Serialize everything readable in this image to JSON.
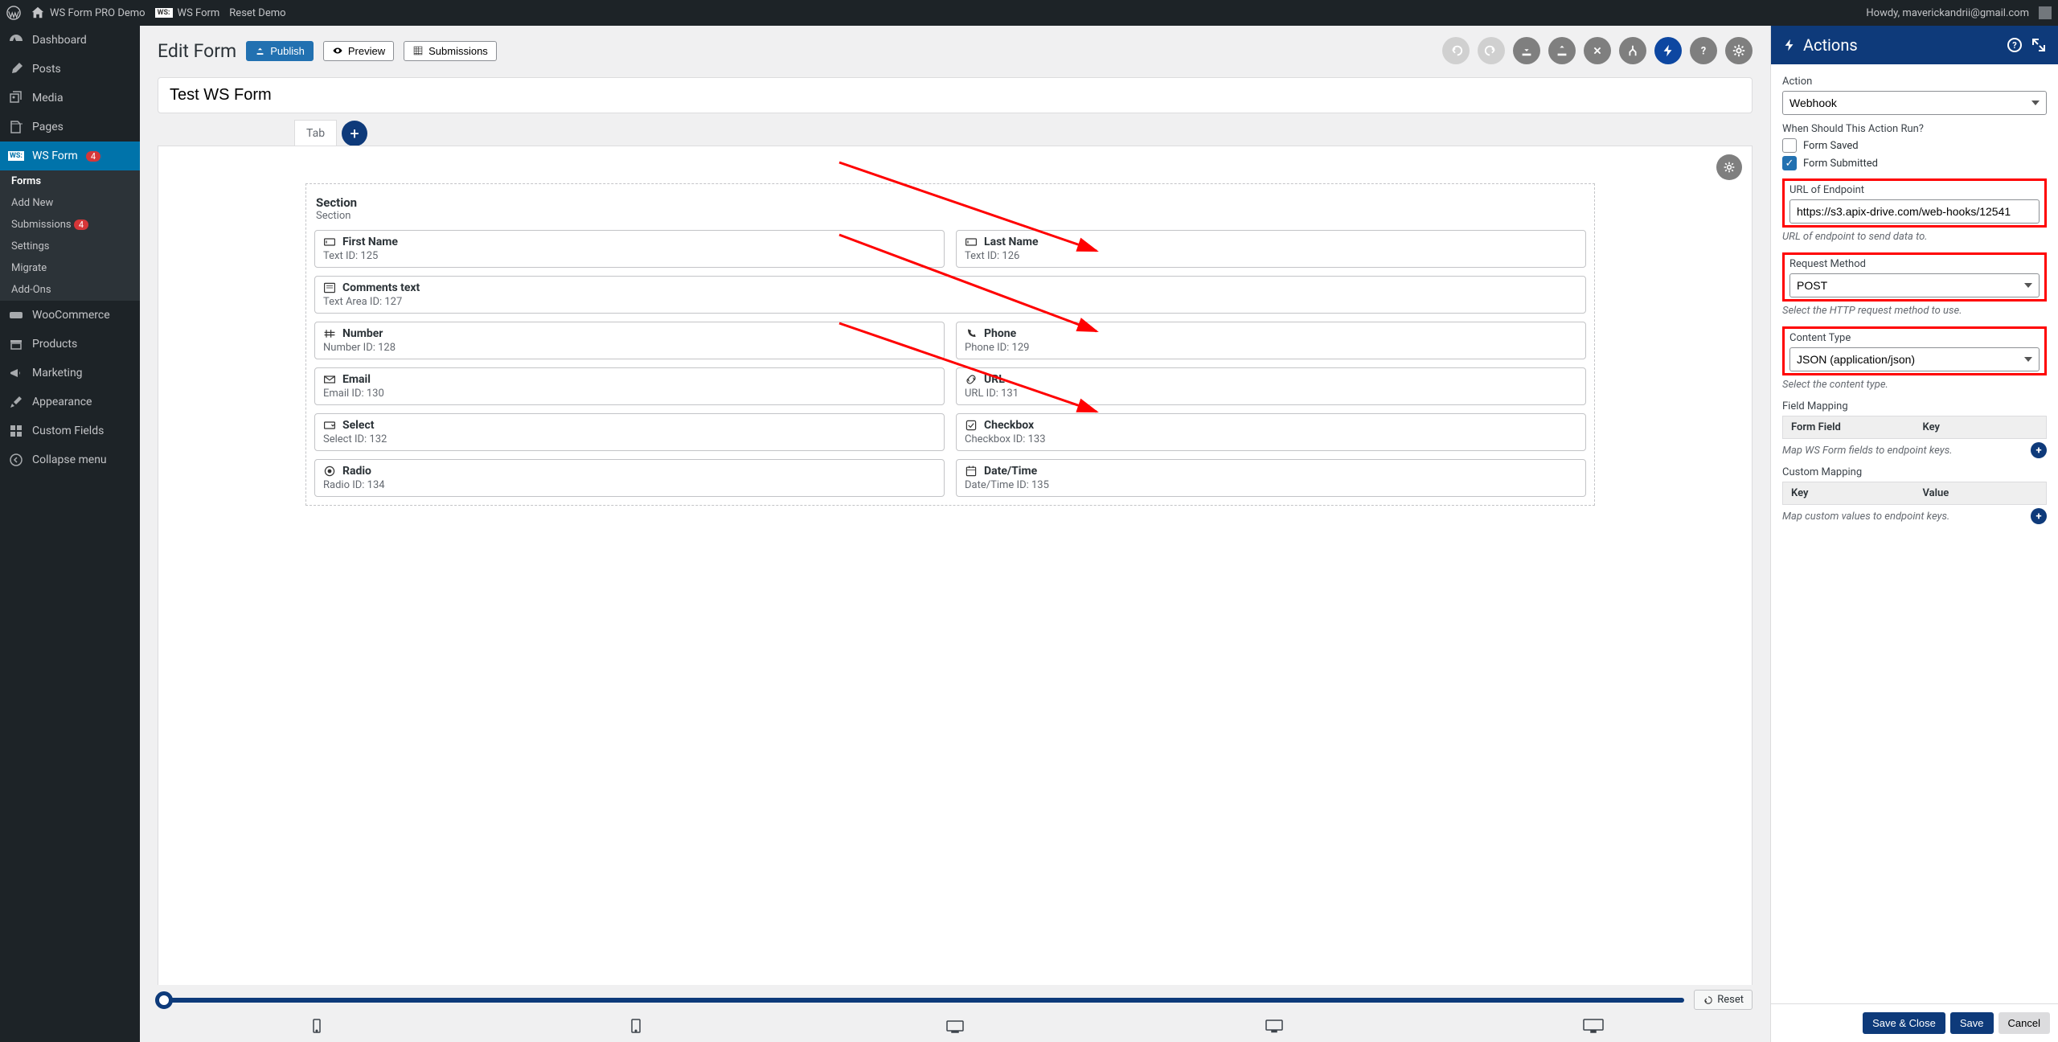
{
  "topbar": {
    "site": "WS Form PRO Demo",
    "wsform": "WS Form",
    "reset": "Reset Demo",
    "howdy": "Howdy, maverickandrii@gmail.com"
  },
  "sidebar": {
    "items": [
      {
        "label": "Dashboard",
        "icon": "dashboard"
      },
      {
        "label": "Posts",
        "icon": "pin"
      },
      {
        "label": "Media",
        "icon": "media"
      },
      {
        "label": "Pages",
        "icon": "pages"
      },
      {
        "label": "WS Form",
        "icon": "wsform",
        "active": true,
        "badge": "4"
      },
      {
        "label": "WooCommerce",
        "icon": "woo"
      },
      {
        "label": "Products",
        "icon": "products"
      },
      {
        "label": "Marketing",
        "icon": "marketing"
      },
      {
        "label": "Appearance",
        "icon": "appearance"
      },
      {
        "label": "Custom Fields",
        "icon": "customfields"
      },
      {
        "label": "Collapse menu",
        "icon": "collapse"
      }
    ],
    "sub": [
      {
        "label": "Forms",
        "sel": true
      },
      {
        "label": "Add New"
      },
      {
        "label": "Submissions",
        "badge": "4"
      },
      {
        "label": "Settings"
      },
      {
        "label": "Migrate"
      },
      {
        "label": "Add-Ons"
      }
    ]
  },
  "header": {
    "title": "Edit Form",
    "publish": "Publish",
    "preview": "Preview",
    "submissions": "Submissions"
  },
  "form": {
    "name": "Test WS Form",
    "tab": "Tab"
  },
  "section": {
    "title": "Section",
    "sub": "Section"
  },
  "fields": [
    {
      "name": "First Name",
      "meta": "Text  ID: 125",
      "icon": "text"
    },
    {
      "name": "Last Name",
      "meta": "Text  ID: 126",
      "icon": "text"
    },
    {
      "name": "Comments text",
      "meta": "Text Area  ID: 127",
      "icon": "textarea",
      "full": true
    },
    {
      "name": "Number",
      "meta": "Number  ID: 128",
      "icon": "number"
    },
    {
      "name": "Phone",
      "meta": "Phone  ID: 129",
      "icon": "phone"
    },
    {
      "name": "Email",
      "meta": "Email  ID: 130",
      "icon": "email"
    },
    {
      "name": "URL",
      "meta": "URL  ID: 131",
      "icon": "url"
    },
    {
      "name": "Select",
      "meta": "Select  ID: 132",
      "icon": "select"
    },
    {
      "name": "Checkbox",
      "meta": "Checkbox  ID: 133",
      "icon": "checkbox"
    },
    {
      "name": "Radio",
      "meta": "Radio  ID: 134",
      "icon": "radio"
    },
    {
      "name": "Date/Time",
      "meta": "Date/Time  ID: 135",
      "icon": "datetime"
    }
  ],
  "bottom": {
    "reset": "Reset"
  },
  "panel": {
    "title": "Actions",
    "action_label": "Action",
    "action_value": "Webhook",
    "when_label": "When Should This Action Run?",
    "form_saved": "Form Saved",
    "form_submitted": "Form Submitted",
    "url_label": "URL of Endpoint",
    "url_value": "https://s3.apix-drive.com/web-hooks/12541",
    "url_help": "URL of endpoint to send data to.",
    "method_label": "Request Method",
    "method_value": "POST",
    "method_help": "Select the HTTP request method to use.",
    "ctype_label": "Content Type",
    "ctype_value": "JSON (application/json)",
    "ctype_help": "Select the content type.",
    "fmap_label": "Field Mapping",
    "fmap_col1": "Form Field",
    "fmap_col2": "Key",
    "fmap_help": "Map WS Form fields to endpoint keys.",
    "cmap_label": "Custom Mapping",
    "cmap_col1": "Key",
    "cmap_col2": "Value",
    "cmap_help": "Map custom values to endpoint keys.",
    "save_close": "Save & Close",
    "save": "Save",
    "cancel": "Cancel"
  }
}
